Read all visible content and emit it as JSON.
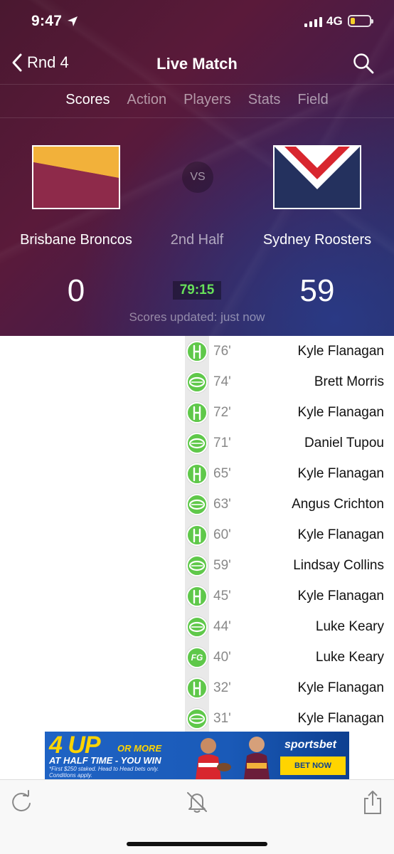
{
  "status_bar": {
    "time": "9:47",
    "network": "4G"
  },
  "nav": {
    "back_label": "Rnd 4",
    "title": "Live Match"
  },
  "tabs": [
    {
      "label": "Scores",
      "active": true
    },
    {
      "label": "Action",
      "active": false
    },
    {
      "label": "Players",
      "active": false
    },
    {
      "label": "Stats",
      "active": false
    },
    {
      "label": "Field",
      "active": false
    }
  ],
  "match": {
    "home": {
      "name": "Brisbane Broncos",
      "score": "0"
    },
    "away": {
      "name": "Sydney Roosters",
      "score": "59"
    },
    "vs_label": "VS",
    "period": "2nd Half",
    "clock": "79:15",
    "updated": "Scores updated: just now"
  },
  "events": [
    {
      "minute": "76'",
      "player": "Kyle Flanagan",
      "type": "conversion",
      "icon": "goalpost-icon"
    },
    {
      "minute": "74'",
      "player": "Brett Morris",
      "type": "try",
      "icon": "football-icon"
    },
    {
      "minute": "72'",
      "player": "Kyle Flanagan",
      "type": "conversion",
      "icon": "goalpost-icon"
    },
    {
      "minute": "71'",
      "player": "Daniel Tupou",
      "type": "try",
      "icon": "football-icon"
    },
    {
      "minute": "65'",
      "player": "Kyle Flanagan",
      "type": "conversion",
      "icon": "goalpost-icon"
    },
    {
      "minute": "63'",
      "player": "Angus Crichton",
      "type": "try",
      "icon": "football-icon"
    },
    {
      "minute": "60'",
      "player": "Kyle Flanagan",
      "type": "conversion",
      "icon": "goalpost-icon"
    },
    {
      "minute": "59'",
      "player": "Lindsay Collins",
      "type": "try",
      "icon": "football-icon"
    },
    {
      "minute": "45'",
      "player": "Kyle Flanagan",
      "type": "conversion",
      "icon": "goalpost-icon"
    },
    {
      "minute": "44'",
      "player": "Luke Keary",
      "type": "try",
      "icon": "football-icon"
    },
    {
      "minute": "40'",
      "player": "Luke Keary",
      "type": "field-goal",
      "icon": "field-goal-icon",
      "icon_text": "FG"
    },
    {
      "minute": "32'",
      "player": "Kyle Flanagan",
      "type": "conversion",
      "icon": "goalpost-icon"
    },
    {
      "minute": "31'",
      "player": "Kyle Flanagan",
      "type": "try",
      "icon": "football-icon"
    }
  ],
  "ad": {
    "headline": "4 UP",
    "or_more": "OR MORE",
    "line2": "AT HALF TIME - YOU WIN",
    "fine_print": "*First $250 staked. Head to Head bets only. Conditions apply.",
    "brand": "sportsbet",
    "cta": "BET NOW"
  },
  "colors": {
    "event_icon": "#5fc84a",
    "clock": "#67e05a",
    "broncos_maroon": "#8e2a4a",
    "broncos_gold": "#f2b13a",
    "roosters_navy": "#24315e",
    "roosters_red": "#d8262e"
  },
  "toolbar": {
    "icons": [
      "refresh-icon",
      "bell-muted-icon",
      "share-icon"
    ]
  }
}
